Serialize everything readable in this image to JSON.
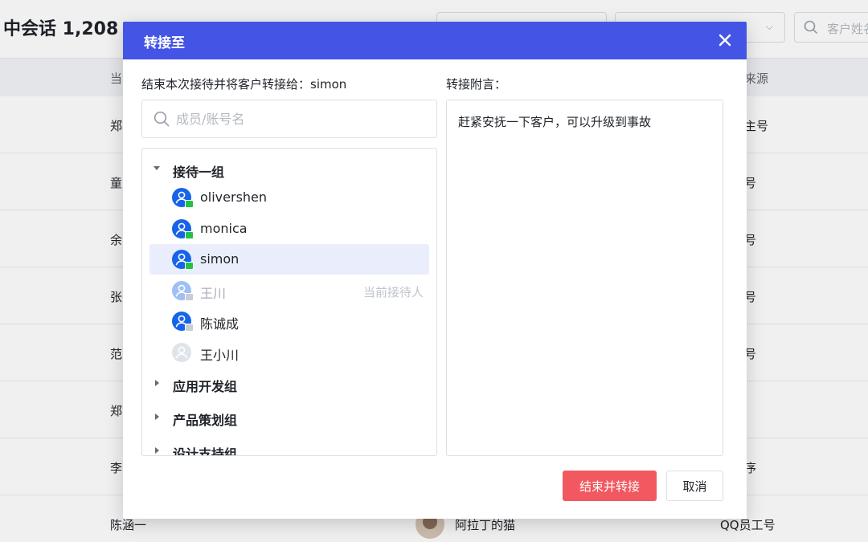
{
  "background": {
    "title": "中会话 1,208",
    "search_placeholder": "客户姓名",
    "table_headers": [
      "当",
      "来源"
    ],
    "rows": [
      {
        "name": "郑",
        "nickname": "",
        "source": "企业主号"
      },
      {
        "name": "童",
        "nickname": "",
        "source": "员工号"
      },
      {
        "name": "余",
        "nickname": "",
        "source": "公众号"
      },
      {
        "name": "张",
        "nickname": "",
        "source": "员工号"
      },
      {
        "name": "范",
        "nickname": "",
        "source": "公众号"
      },
      {
        "name": "郑",
        "nickname": "",
        "source": ""
      },
      {
        "name": "李",
        "nickname": "",
        "source": "小程序"
      },
      {
        "name": "陈涵一",
        "nickname": "阿拉丁的猫",
        "source": "QQ员工号"
      }
    ]
  },
  "modal": {
    "title": "转接至",
    "transfer_label": "结束本次接待并将客户转接给：simon",
    "note_label": "转接附言：",
    "search_placeholder": "成员/账号名",
    "note_text": "赶紧安抚一下客户，可以升级到事故",
    "confirm_label": "结束并转接",
    "cancel_label": "取消",
    "groups": [
      {
        "name": "接待一组",
        "expanded": true,
        "members": [
          {
            "name": "olivershen",
            "state": "online",
            "status": "",
            "selected": false
          },
          {
            "name": "monica",
            "state": "online",
            "status": "",
            "selected": false
          },
          {
            "name": "simon",
            "state": "online",
            "status": "",
            "selected": true
          },
          {
            "name": "王川",
            "state": "current",
            "status": "当前接待人",
            "selected": false
          },
          {
            "name": "陈诚成",
            "state": "away",
            "status": "",
            "selected": false
          },
          {
            "name": "王小川",
            "state": "offline",
            "status": "",
            "selected": false
          }
        ]
      },
      {
        "name": "应用开发组",
        "expanded": false,
        "members": []
      },
      {
        "name": "产品策划组",
        "expanded": false,
        "members": []
      },
      {
        "name": "设计支持组",
        "expanded": false,
        "members": []
      }
    ]
  },
  "colors": {
    "header": "#4455e6",
    "confirm": "#f2585f",
    "avatar": "#1664e8",
    "online_badge": "#23c343",
    "selected_row": "#eaeefc"
  },
  "icons": {
    "close": "close-icon",
    "search": "search-icon",
    "expand": "caret-down-icon",
    "collapse": "caret-right-icon",
    "user": "user-icon"
  }
}
